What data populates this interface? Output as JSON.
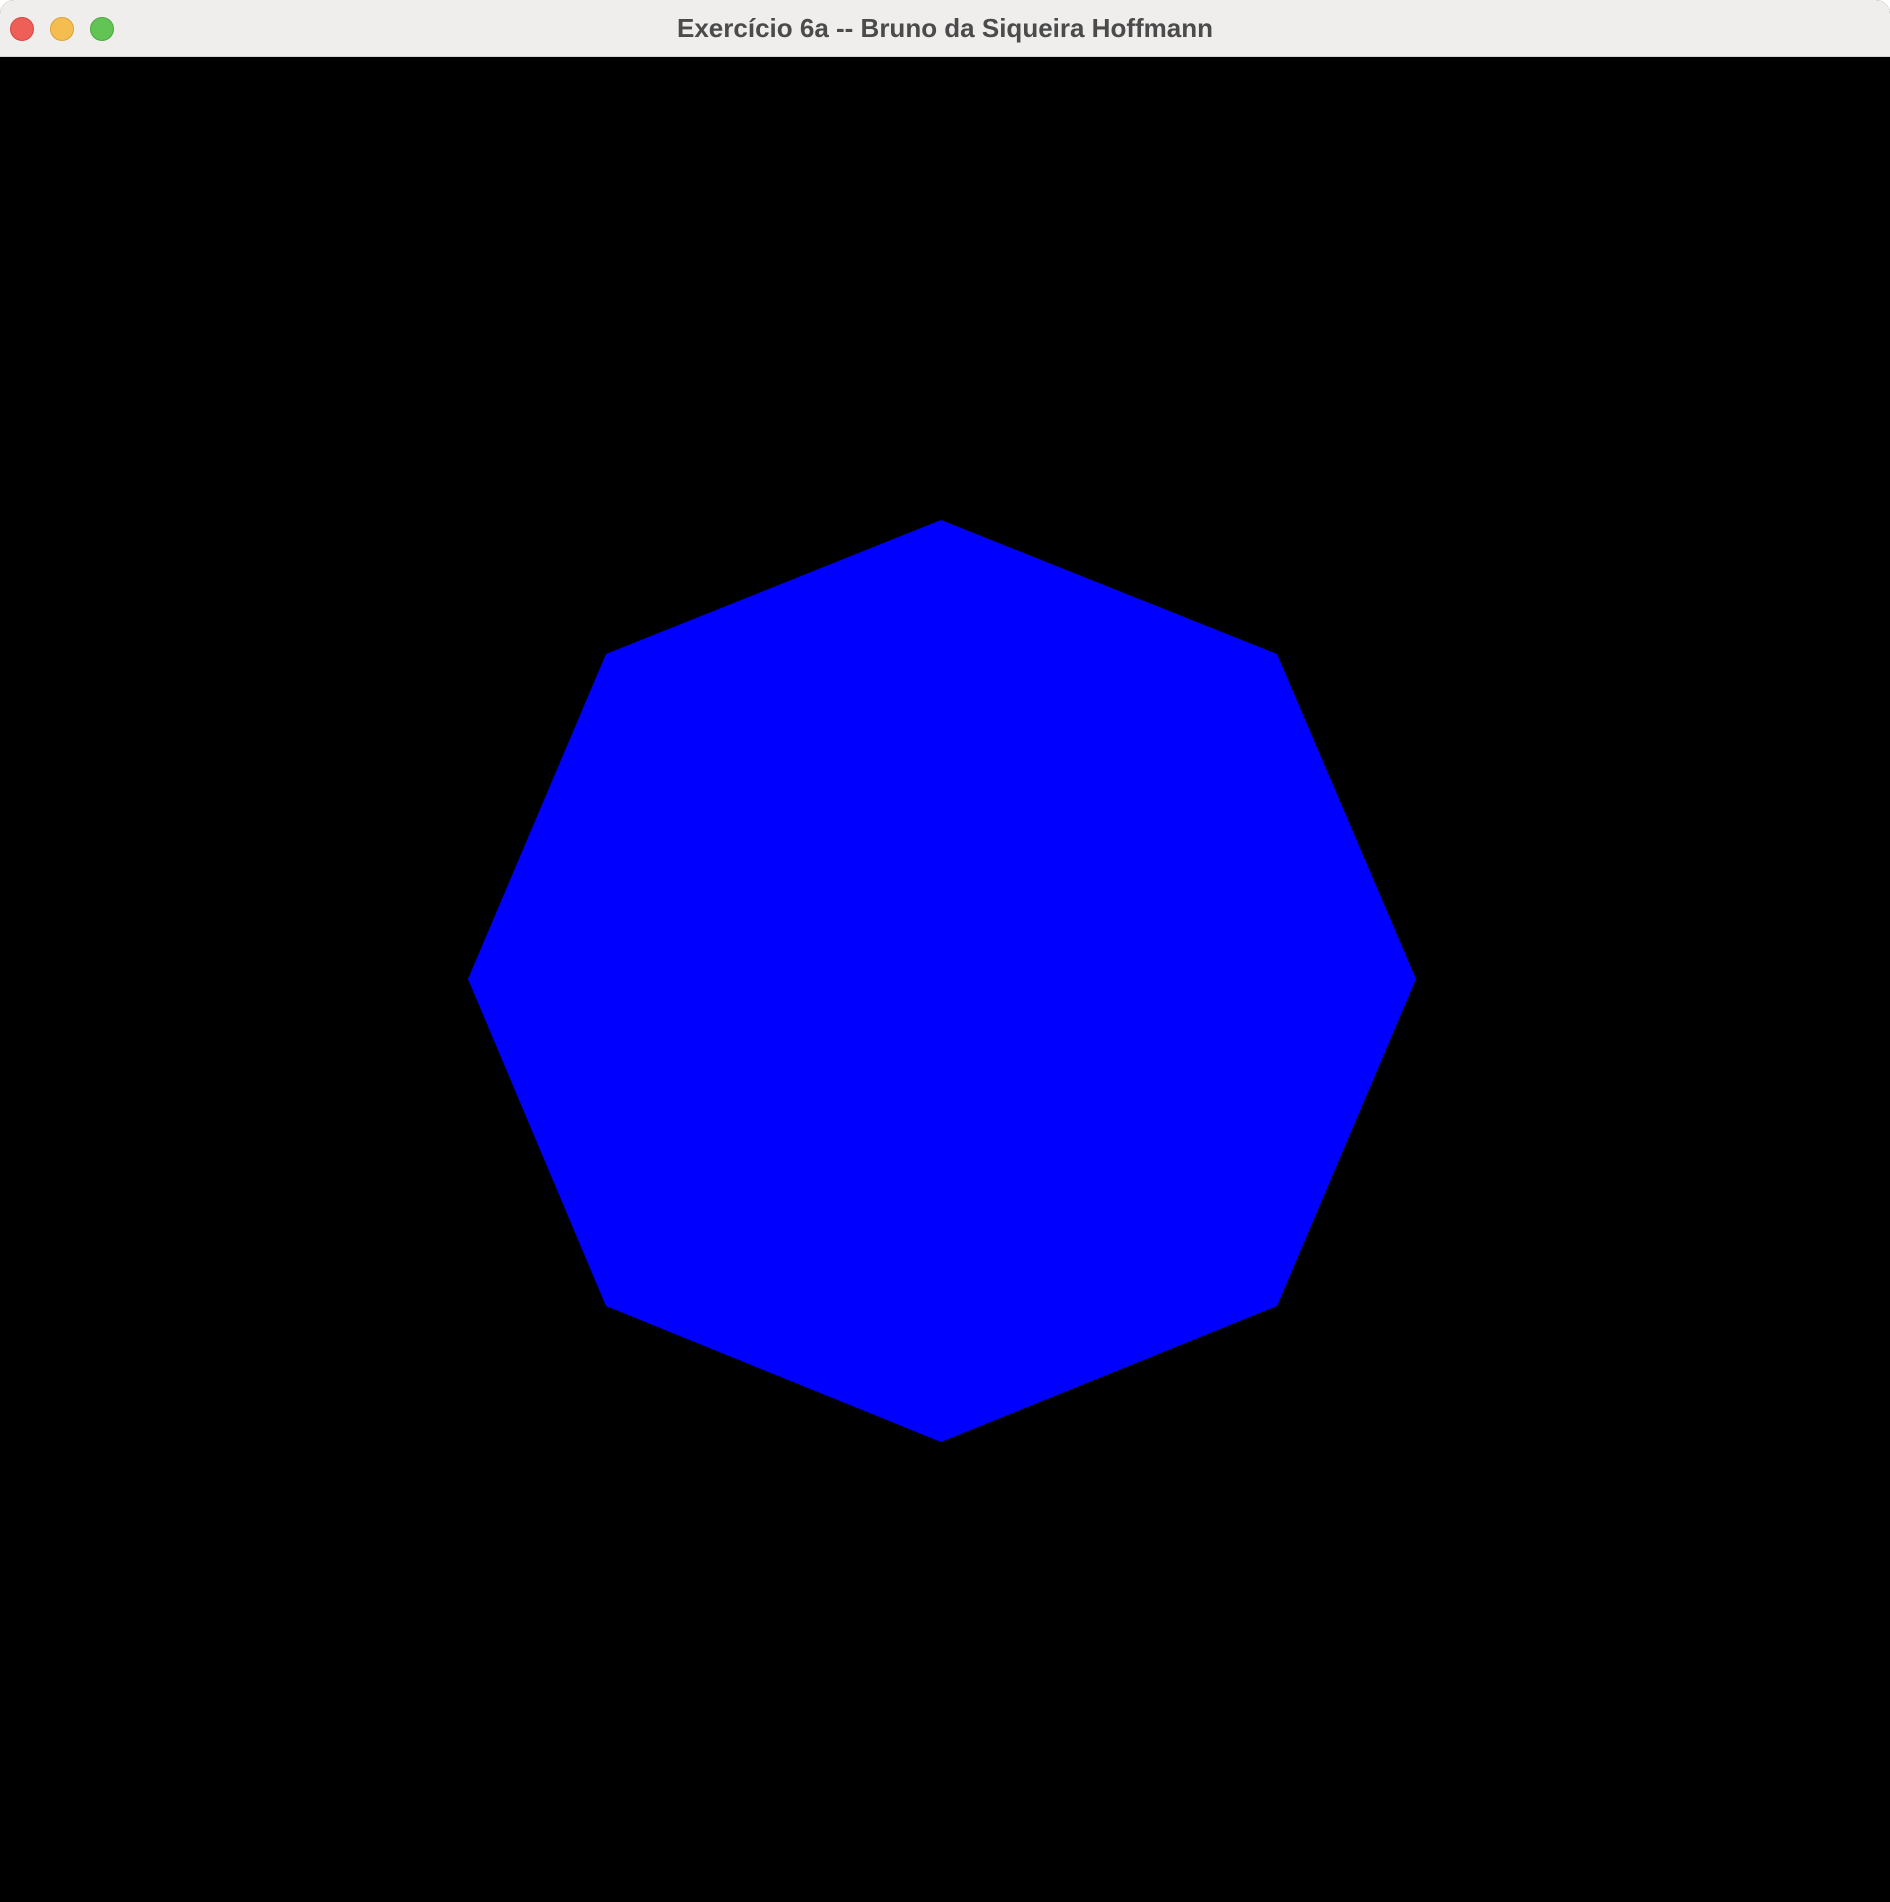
{
  "window": {
    "title": "Exercício 6a -- Bruno da Siqueira Hoffmann"
  },
  "traffic_lights": {
    "close_color": "#ee5f57",
    "minimize_color": "#f5bd4f",
    "zoom_color": "#61c454"
  },
  "canvas": {
    "background_color": "#000000"
  },
  "shape": {
    "type": "octagon",
    "sides": 8,
    "fill_color": "#0000ff"
  }
}
